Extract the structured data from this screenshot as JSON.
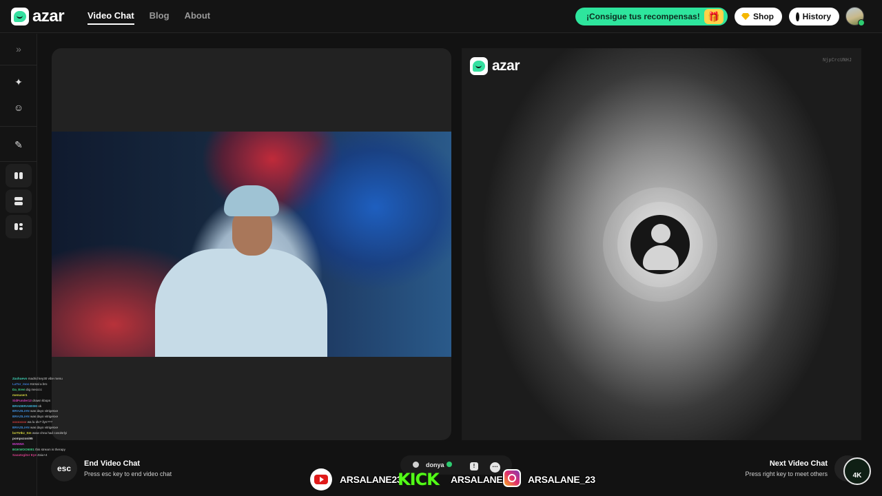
{
  "brand": {
    "logo_text": "azar",
    "accent": "#2ee59d"
  },
  "nav": {
    "video_chat": "Video Chat",
    "blog": "Blog",
    "about": "About"
  },
  "promo": {
    "label": "¡Consigue tus recompensas!",
    "icon": "gift-icon"
  },
  "shop": {
    "label": "Shop",
    "icon": "diamond-icon"
  },
  "history": {
    "label": "History",
    "icon": "clock-icon"
  },
  "sidebar": {
    "items": [
      {
        "name": "expand-icon",
        "glyph": "»"
      },
      {
        "name": "magic-wand-icon",
        "glyph": "✦"
      },
      {
        "name": "face-filter-icon",
        "glyph": "☺"
      },
      {
        "name": "edit-icon",
        "glyph": "✎"
      },
      {
        "name": "layout-side-by-side-icon"
      },
      {
        "name": "layout-stacked-icon"
      },
      {
        "name": "layout-grid-icon"
      }
    ]
  },
  "remote": {
    "logo_text": "azar",
    "session_code": "NjpCrcUNHJ"
  },
  "chat_log": [
    {
      "user": "Zaxhuevo",
      "user_color": "#3fd5b8",
      "text": "madrid key30 vibe menu"
    },
    {
      "user": "LaTor_moo",
      "user_color": "#3f7bd5",
      "text": "Ksmal a bro"
    },
    {
      "user": "Da_Eren",
      "user_color": "#3fd58a",
      "text": "dig mecccc"
    },
    {
      "user": "menuser1",
      "user_color": "#d5d53f",
      "text": ""
    },
    {
      "user": "SidFunder13",
      "user_color": "#d53fb4",
      "text": "drawn kbops"
    },
    {
      "user": "BRADBRAM00M",
      "user_color": "#3fb0d5",
      "text": "ok"
    },
    {
      "user": "BRAZILIAN",
      "user_color": "#3f8ad5",
      "text": "was dayo vitrigesxe"
    },
    {
      "user": "BRAZILIAN",
      "user_color": "#3f8ad5",
      "text": "was dayo vitrigesxe"
    },
    {
      "user": "xxxxxxxx",
      "user_color": "#d53f3f",
      "text": "wa lu olv? ilyn???"
    },
    {
      "user": "BRAZILIAN",
      "user_color": "#3f8ad5",
      "text": "was dayo vitrigesxe"
    },
    {
      "user": "boTtrIkz_Sm",
      "user_color": "#d5d53f",
      "text": "www chna had cosolsrlyi"
    },
    {
      "user": "pompozoni95",
      "user_color": "#d5d5d5",
      "text": ""
    },
    {
      "user": "MANNA",
      "user_color": "#d53fd5",
      "text": ""
    },
    {
      "user": "BGKWOO5001",
      "user_color": "#3fd58a",
      "text": "this stream is therapy"
    },
    {
      "user": "Saoatogitor Eye",
      "user_color": "#d53f8a",
      "text": "Zaiu+4"
    }
  ],
  "end_chat": {
    "key": "esc",
    "title": "End Video Chat",
    "subtitle": "Press esc key to end video chat"
  },
  "next_chat": {
    "title": "Next Video Chat",
    "subtitle": "Press right key to meet others"
  },
  "partner": {
    "name": "donya",
    "report_icon": "!",
    "more_icon": "…"
  },
  "social": {
    "youtube_handle": "ARSALANE23",
    "kick_logo": "KICK",
    "kick_handle": "ARSALANE1",
    "instagram_handle": "ARSALANE_23"
  },
  "badge": {
    "label": "4K"
  }
}
